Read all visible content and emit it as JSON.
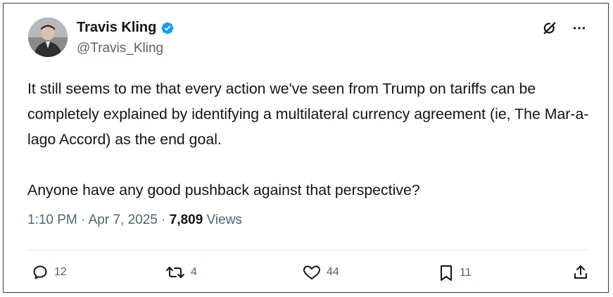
{
  "author": {
    "name": "Travis Kling",
    "handle": "@Travis_Kling"
  },
  "tweet": {
    "paragraphs": [
      "It still seems to me that every action we've seen from Trump on tariffs can be completely explained by identifying a multilateral currency agreement (ie, The Mar-a-lago Accord) as the end goal.",
      "Anyone have any good pushback against that perspective?"
    ]
  },
  "meta": {
    "time": "1:10 PM",
    "sep1": " · ",
    "date": "Apr 7, 2025",
    "sep2": " · ",
    "views_count": "7,809",
    "views_label": " Views"
  },
  "actions": {
    "replies": "12",
    "reposts": "4",
    "likes": "44",
    "bookmarks": "11"
  },
  "colors": {
    "verified": "#1d9bf0",
    "secondary_text": "#536471",
    "primary_text": "#0f1419"
  },
  "icons": [
    "grok-icon",
    "more-icon",
    "reply-icon",
    "repost-icon",
    "like-icon",
    "bookmark-icon",
    "share-icon",
    "verified-badge-icon"
  ]
}
